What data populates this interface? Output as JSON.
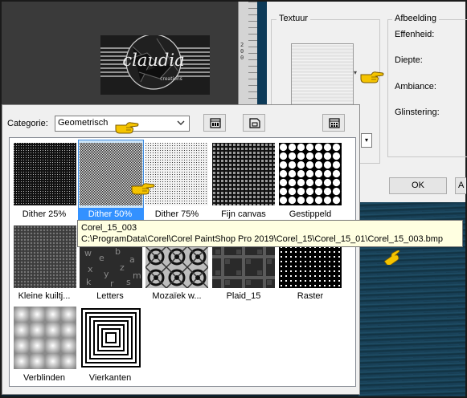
{
  "preview": {
    "logo_text": "claudia",
    "logo_subtext": "creations"
  },
  "ruler": {
    "labels": [
      "2",
      "0",
      "0"
    ]
  },
  "texture_dialog": {
    "textuur_legend": "Textuur",
    "afbeelding_legend": "Afbeelding",
    "fields": [
      "Effenheid:",
      "Diepte:",
      "Ambiance:",
      "Glinstering:"
    ],
    "ok_label": "OK",
    "extra_button_label": "A"
  },
  "browser": {
    "category_label": "Categorie:",
    "category_value": "Geometrisch",
    "selected_index": 1,
    "tiles": [
      {
        "label": "Dither 25%",
        "pattern": "dither-25"
      },
      {
        "label": "Dither 50%",
        "pattern": "dither-50"
      },
      {
        "label": "Dither 75%",
        "pattern": "dither-75"
      },
      {
        "label": "Fijn canvas",
        "pattern": "fine-canvas"
      },
      {
        "label": "Gestippeld",
        "pattern": "dotted"
      },
      {
        "label": "Kleine kuiltj...",
        "pattern": "small-dimples"
      },
      {
        "label": "Letters",
        "pattern": "letters"
      },
      {
        "label": "Mozaïek w...",
        "pattern": "mosaic"
      },
      {
        "label": "Plaid_15",
        "pattern": "plaid"
      },
      {
        "label": "Raster",
        "pattern": "raster"
      },
      {
        "label": "Verblinden",
        "pattern": "blinds"
      },
      {
        "label": "Vierkanten",
        "pattern": "squares"
      }
    ]
  },
  "tooltip": {
    "name": "Corel_15_003",
    "path": "C:\\ProgramData\\Corel\\Corel PaintShop Pro 2019\\Corel_15\\Corel_15_01\\Corel_15_003.bmp"
  },
  "colors": {
    "selection_bg": "#cce4f7",
    "selection_label_bg": "#3391ff",
    "tooltip_bg": "#ffffe1",
    "pointer_hand": "#f5c400"
  },
  "icons": {
    "toolbar": [
      "panel-toggle-icon",
      "save-preset-icon",
      "grid-view-icon"
    ],
    "pointer": "pointing-hand-icon"
  }
}
